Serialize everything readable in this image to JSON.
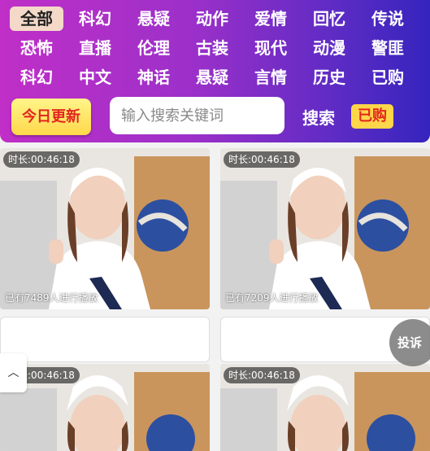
{
  "categories": {
    "items": [
      {
        "label": "全部",
        "active": true
      },
      {
        "label": "科幻"
      },
      {
        "label": "悬疑"
      },
      {
        "label": "动作"
      },
      {
        "label": "爱情"
      },
      {
        "label": "回忆"
      },
      {
        "label": "传说"
      },
      {
        "label": "恐怖"
      },
      {
        "label": "直播"
      },
      {
        "label": "伦理"
      },
      {
        "label": "古装"
      },
      {
        "label": "现代"
      },
      {
        "label": "动漫"
      },
      {
        "label": "警匪"
      },
      {
        "label": "科幻"
      },
      {
        "label": "中文"
      },
      {
        "label": "神话"
      },
      {
        "label": "悬疑"
      },
      {
        "label": "言情"
      },
      {
        "label": "历史"
      },
      {
        "label": "已购"
      }
    ]
  },
  "toolbar": {
    "today_label": "今日更新",
    "search_placeholder": "输入搜索关键词",
    "search_label": "搜索",
    "bought_label": "已购"
  },
  "videos": [
    {
      "duration": "时长:00:46:18",
      "views": "已有7489人进行播放"
    },
    {
      "duration": "时长:00:46:18",
      "views": "已有7209人进行播放"
    },
    {
      "duration": "时长:00:46:18",
      "views": ""
    },
    {
      "duration": "时长:00:46:18",
      "views": ""
    }
  ],
  "floating": {
    "report_label": "投诉",
    "top_icon": "chevron-up-icon"
  },
  "colors": {
    "header_start": "#c02fc7",
    "header_end": "#3524bd",
    "accent_yellow": "#ffd54a",
    "accent_red": "#e2261f"
  }
}
